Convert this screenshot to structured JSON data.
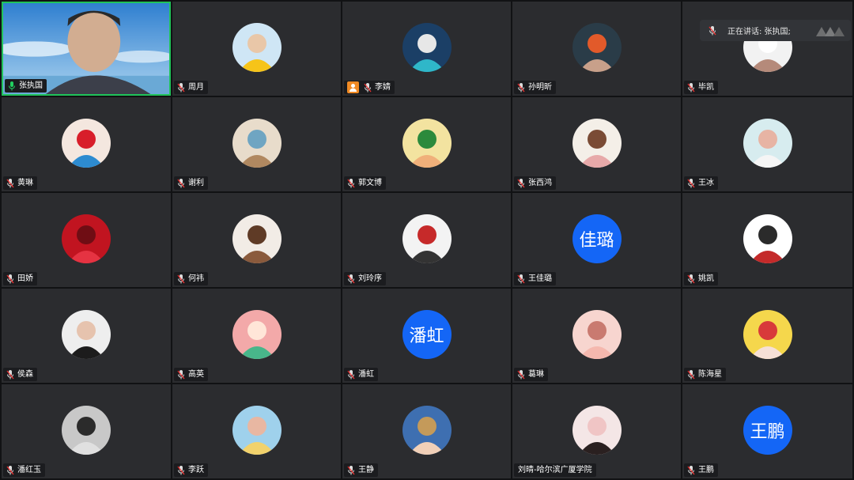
{
  "speaker_banner": {
    "text": "正在讲话: 张执国;"
  },
  "colors": {
    "tile_bg": "#2b2c2f",
    "active_border": "#20c35a",
    "initials_bg": "#1466f6",
    "host_badge": "#f08a24"
  },
  "participants": [
    {
      "name": "张执国",
      "mic": "active",
      "video": true,
      "row": 0,
      "col": 0,
      "avatar": "video-feed"
    },
    {
      "name": "周月",
      "mic": "muted",
      "row": 0,
      "col": 1,
      "avatar": "photo-child-yellow-hat"
    },
    {
      "name": "李婧",
      "mic": "muted",
      "host": true,
      "row": 0,
      "col": 2,
      "avatar": "photo-anime"
    },
    {
      "name": "孙明昕",
      "mic": "muted",
      "row": 0,
      "col": 3,
      "avatar": "photo-woman-boat"
    },
    {
      "name": "毕凯",
      "mic": "muted",
      "row": 0,
      "col": 4,
      "avatar": "photo-flower"
    },
    {
      "name": "黄琳",
      "mic": "muted",
      "row": 1,
      "col": 0,
      "avatar": "photo-sunglasses"
    },
    {
      "name": "谢利",
      "mic": "muted",
      "row": 1,
      "col": 1,
      "avatar": "photo-drawing-girl"
    },
    {
      "name": "郭文博",
      "mic": "muted",
      "row": 1,
      "col": 2,
      "avatar": "photo-cartoon-kids"
    },
    {
      "name": "张西鸿",
      "mic": "muted",
      "row": 1,
      "col": 3,
      "avatar": "photo-cartoon-glasses"
    },
    {
      "name": "王冰",
      "mic": "muted",
      "row": 1,
      "col": 4,
      "avatar": "photo-paper-hand"
    },
    {
      "name": "田娇",
      "mic": "muted",
      "row": 2,
      "col": 0,
      "avatar": "photo-red-fruit"
    },
    {
      "name": "何祎",
      "mic": "muted",
      "row": 2,
      "col": 1,
      "avatar": "photo-bear"
    },
    {
      "name": "刘玲序",
      "mic": "muted",
      "row": 2,
      "col": 2,
      "avatar": "photo-ink-art"
    },
    {
      "name": "王佳璐",
      "mic": "muted",
      "row": 2,
      "col": 3,
      "avatar": "initials",
      "initials": "佳璐"
    },
    {
      "name": "姚凯",
      "mic": "muted",
      "row": 2,
      "col": 4,
      "avatar": "photo-seal-calligraphy"
    },
    {
      "name": "侯森",
      "mic": "muted",
      "row": 3,
      "col": 0,
      "avatar": "photo-girl-portrait"
    },
    {
      "name": "高英",
      "mic": "muted",
      "row": 3,
      "col": 1,
      "avatar": "photo-illustration-green"
    },
    {
      "name": "潘虹",
      "mic": "muted",
      "row": 3,
      "col": 2,
      "avatar": "initials",
      "initials": "潘虹"
    },
    {
      "name": "葛琳",
      "mic": "muted",
      "row": 3,
      "col": 3,
      "avatar": "photo-pink-blob"
    },
    {
      "name": "陈海星",
      "mic": "muted",
      "row": 3,
      "col": 4,
      "avatar": "photo-doll-face"
    },
    {
      "name": "潘红玉",
      "mic": "muted",
      "row": 4,
      "col": 0,
      "avatar": "photo-child-walking"
    },
    {
      "name": "李跃",
      "mic": "muted",
      "row": 4,
      "col": 1,
      "avatar": "photo-alice"
    },
    {
      "name": "王静",
      "mic": "muted",
      "row": 4,
      "col": 2,
      "avatar": "photo-child-smile"
    },
    {
      "name": "刘晴-哈尔滨广厦学院",
      "mic": "none",
      "row": 4,
      "col": 3,
      "avatar": "photo-woman-smile"
    },
    {
      "name": "王鹏",
      "mic": "muted",
      "row": 4,
      "col": 4,
      "avatar": "initials",
      "initials": "王鹏"
    }
  ]
}
